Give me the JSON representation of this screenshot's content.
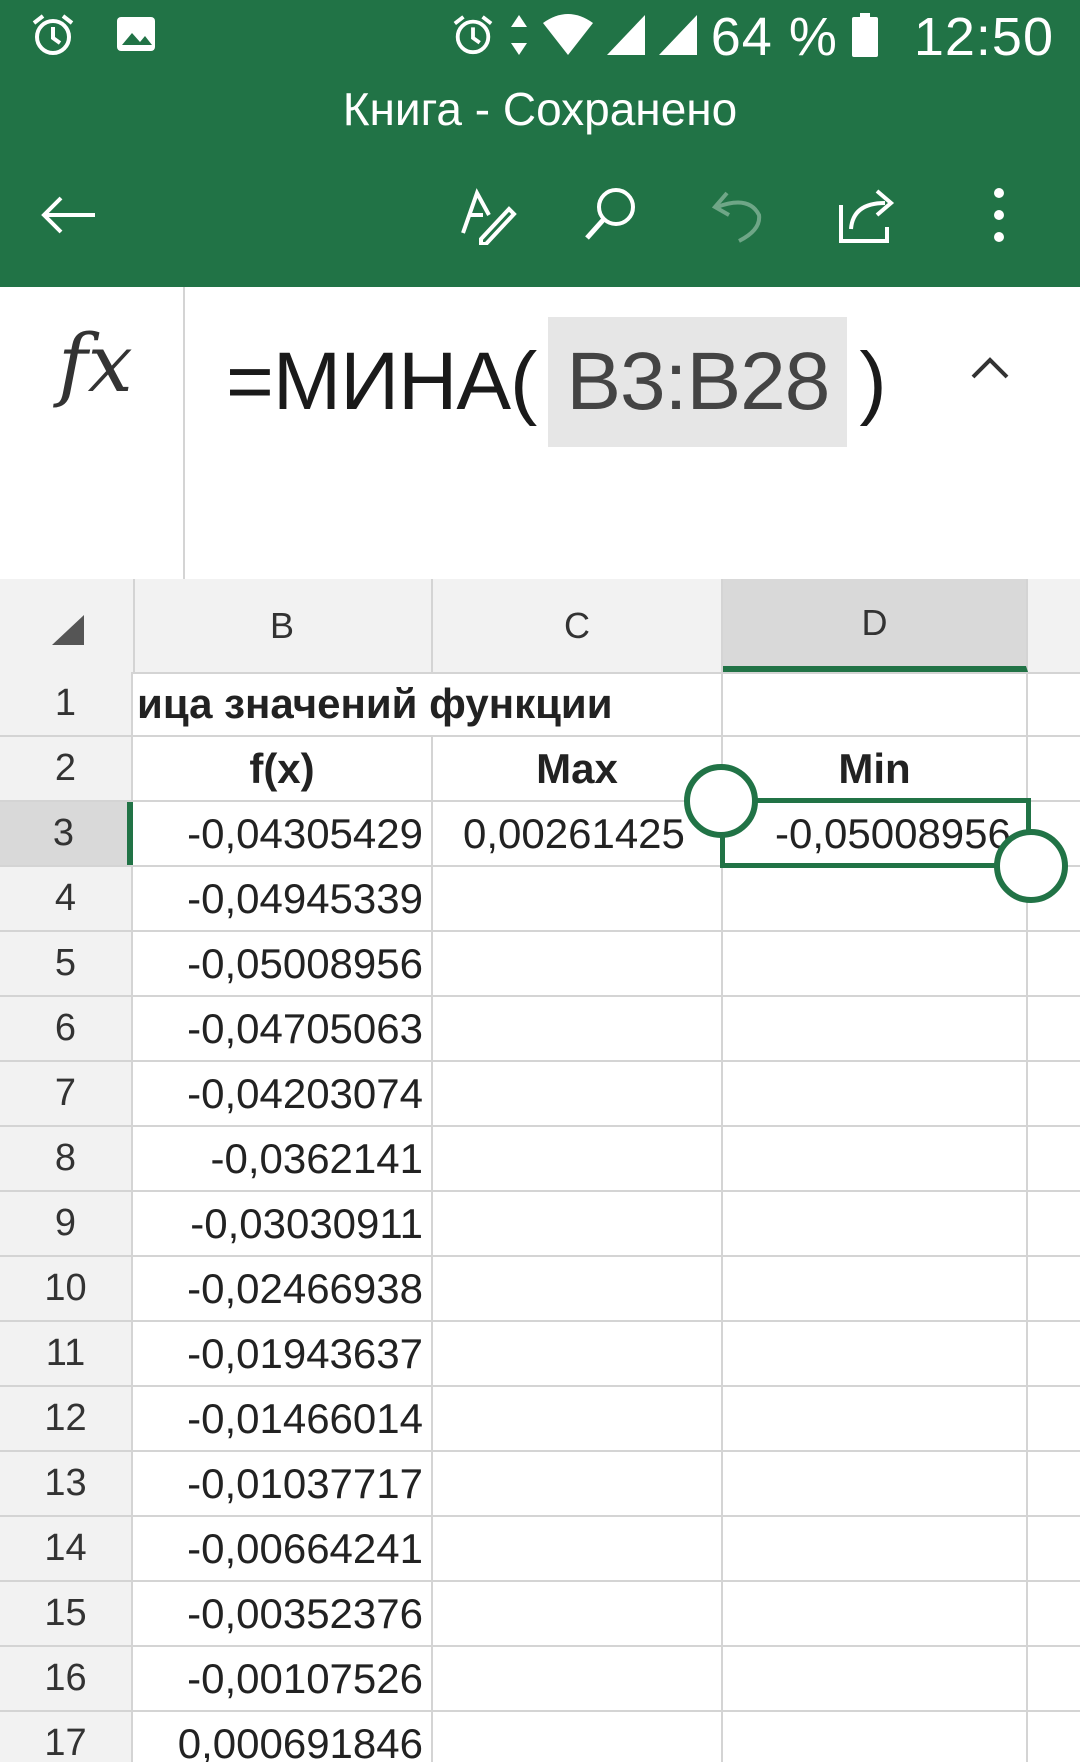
{
  "status_bar": {
    "battery_percent": "64 %",
    "time": "12:50"
  },
  "app": {
    "title": "Книга - Сохранено",
    "accent_color": "#217346",
    "toolbar": {
      "back_icon": "arrow-left-icon",
      "draw_icon": "pen-draw-icon",
      "search_icon": "search-icon",
      "undo_icon": "undo-icon",
      "share_icon": "share-icon",
      "more_icon": "more-vertical-icon"
    }
  },
  "formula_bar": {
    "fx_label": "fx",
    "prefix": "=МИНА(",
    "range": "B3:B28",
    "suffix": ")"
  },
  "grid": {
    "columns": [
      "B",
      "C",
      "D"
    ],
    "selected_column": "D",
    "selected_row": "3",
    "rows": [
      {
        "num": "1",
        "b": "ица значений функции",
        "c": "",
        "d": ""
      },
      {
        "num": "2",
        "b": "f(x)",
        "c": "Max",
        "d": "Min"
      },
      {
        "num": "3",
        "b": "-0,04305429",
        "c": "0,00261425",
        "d": "-0,05008956"
      },
      {
        "num": "4",
        "b": "-0,04945339",
        "c": "",
        "d": ""
      },
      {
        "num": "5",
        "b": "-0,05008956",
        "c": "",
        "d": ""
      },
      {
        "num": "6",
        "b": "-0,04705063",
        "c": "",
        "d": ""
      },
      {
        "num": "7",
        "b": "-0,04203074",
        "c": "",
        "d": ""
      },
      {
        "num": "8",
        "b": "-0,0362141",
        "c": "",
        "d": ""
      },
      {
        "num": "9",
        "b": "-0,03030911",
        "c": "",
        "d": ""
      },
      {
        "num": "10",
        "b": "-0,02466938",
        "c": "",
        "d": ""
      },
      {
        "num": "11",
        "b": "-0,01943637",
        "c": "",
        "d": ""
      },
      {
        "num": "12",
        "b": "-0,01466014",
        "c": "",
        "d": ""
      },
      {
        "num": "13",
        "b": "-0,01037717",
        "c": "",
        "d": ""
      },
      {
        "num": "14",
        "b": "-0,00664241",
        "c": "",
        "d": ""
      },
      {
        "num": "15",
        "b": "-0,00352376",
        "c": "",
        "d": ""
      },
      {
        "num": "16",
        "b": "-0,00107526",
        "c": "",
        "d": ""
      },
      {
        "num": "17",
        "b": "0,000691846",
        "c": "",
        "d": ""
      }
    ]
  }
}
